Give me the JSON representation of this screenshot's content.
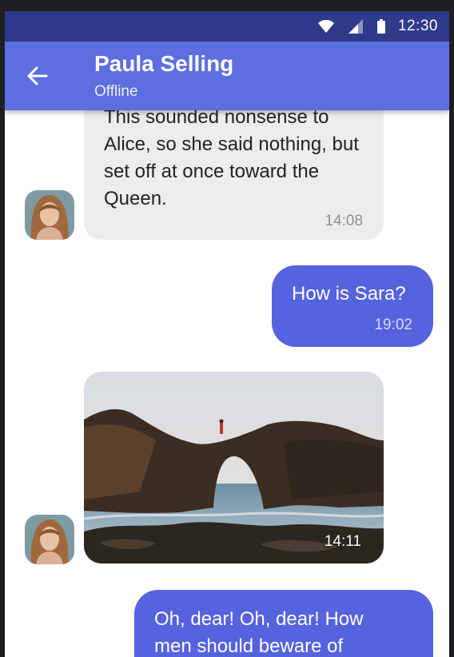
{
  "status_bar": {
    "time": "12:30"
  },
  "header": {
    "name": "Paula Selling",
    "status": "Offline"
  },
  "messages": {
    "m1": {
      "text": "This sounded nonsense to Alice, so she said nothing, but set off at once toward the Queen.",
      "time": "14:08"
    },
    "m2": {
      "text": "How is Sara?",
      "time": "19:02"
    },
    "m3": {
      "time": "14:11"
    },
    "m4": {
      "text": "Oh, dear! Oh, dear! How men should beware of"
    }
  },
  "colors": {
    "status_bar": "#2f3a8a",
    "app_bar": "#5c6ee0",
    "outgoing_bubble": "#5563de",
    "incoming_bubble": "#ededed"
  }
}
